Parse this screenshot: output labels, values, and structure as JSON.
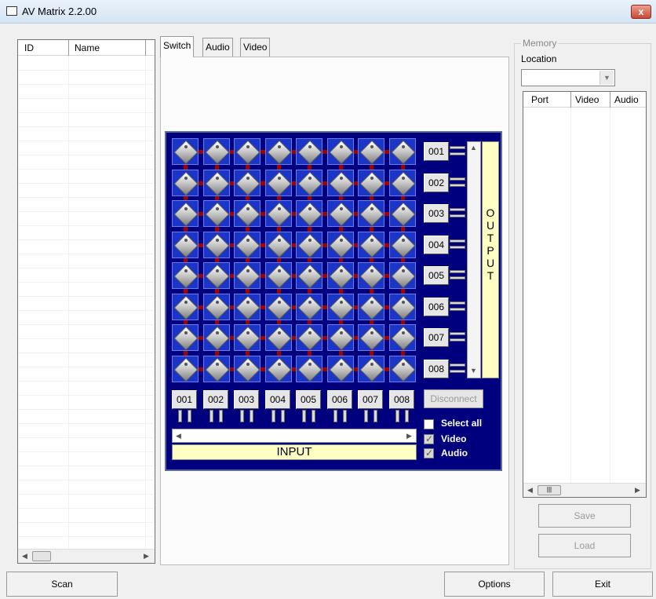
{
  "window": {
    "title": "AV Matrix 2.2.00",
    "close_label": "x"
  },
  "device_list": {
    "columns": [
      "ID",
      "Name"
    ]
  },
  "tabs": [
    {
      "label": "Switch"
    },
    {
      "label": "Audio"
    },
    {
      "label": "Video"
    }
  ],
  "switch": {
    "outputs": [
      "001",
      "002",
      "003",
      "004",
      "005",
      "006",
      "007",
      "008"
    ],
    "inputs": [
      "001",
      "002",
      "003",
      "004",
      "005",
      "006",
      "007",
      "008"
    ],
    "output_label": [
      "O",
      "U",
      "T",
      "P",
      "U",
      "T"
    ],
    "input_label": "INPUT",
    "disconnect_label": "Disconnect",
    "select_all": {
      "label": "Select all",
      "checked": false
    },
    "video": {
      "label": "Video",
      "checked": true
    },
    "audio": {
      "label": "Audio",
      "checked": true
    }
  },
  "memory": {
    "group_label": "Memory",
    "location_label": "Location",
    "location_value": "",
    "columns": [
      "Port",
      "Video",
      "Audio"
    ],
    "save_label": "Save",
    "load_label": "Load"
  },
  "footer": {
    "scan_label": "Scan",
    "options_label": "Options",
    "exit_label": "Exit"
  },
  "icons": {
    "title": "window-icon",
    "close": "close-icon"
  }
}
